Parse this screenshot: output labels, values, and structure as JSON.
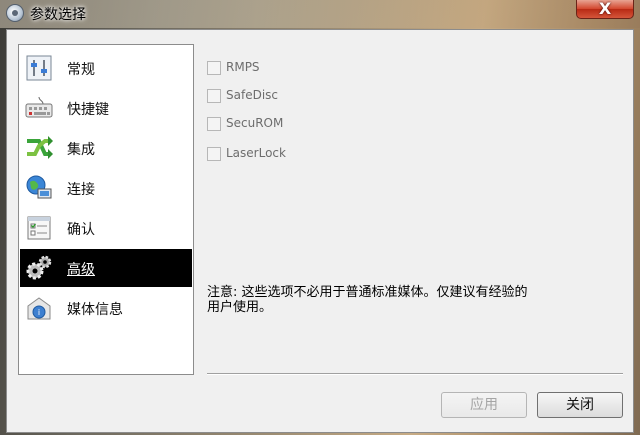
{
  "window": {
    "title": "参数选择",
    "close_glyph": "X"
  },
  "sidebar": {
    "items": [
      {
        "label": "常规",
        "icon": "sliders-icon",
        "active": false
      },
      {
        "label": "快捷键",
        "icon": "keyboard-icon",
        "active": false
      },
      {
        "label": "集成",
        "icon": "integration-arrows-icon",
        "active": false
      },
      {
        "label": "连接",
        "icon": "network-globe-icon",
        "active": false
      },
      {
        "label": "确认",
        "icon": "confirm-list-icon",
        "active": false
      },
      {
        "label": "高级",
        "icon": "gears-icon",
        "active": true
      },
      {
        "label": "媒体信息",
        "icon": "media-info-icon",
        "active": false
      }
    ]
  },
  "options": [
    {
      "label": "RMPS",
      "checked": false,
      "enabled": false
    },
    {
      "label": "SafeDisc",
      "checked": false,
      "enabled": false
    },
    {
      "label": "SecuROM",
      "checked": false,
      "enabled": false
    },
    {
      "label": "LaserLock",
      "checked": false,
      "enabled": false
    }
  ],
  "note": {
    "line1": "注意: 这些选项不必用于普通标准媒体。仅建议有经验的",
    "line2": "用户使用。"
  },
  "footer": {
    "apply_label": "应用",
    "close_label": "关闭"
  },
  "colors": {
    "active_item_bg": "#000000",
    "close_button": "#d2452c"
  }
}
